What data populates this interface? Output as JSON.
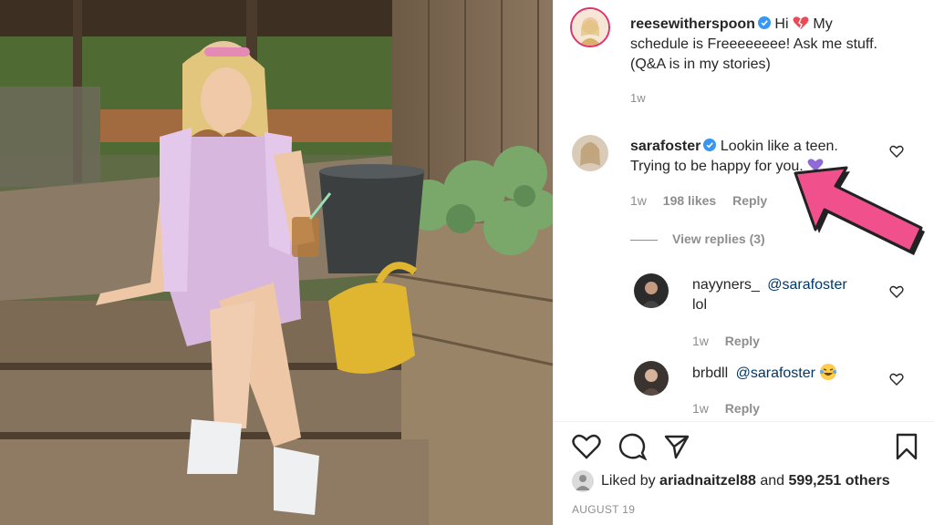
{
  "post": {
    "caption_user": "reesewitherspoon",
    "caption_text_1": "Hi",
    "caption_text_2": "My",
    "caption_line2": "schedule is Freeeeeeee! Ask me stuff.",
    "caption_line3": "(Q&A is in my stories)",
    "caption_time": "1w"
  },
  "comments": [
    {
      "user": "sarafoster",
      "text_1": "Lookin like a teen.",
      "text_2": "Trying to be happy for you.",
      "time": "1w",
      "likes": "198 likes",
      "reply": "Reply",
      "view_replies": "View replies (3)"
    }
  ],
  "replies": [
    {
      "user": "nayyners_",
      "mention": "@sarafoster",
      "text": "lol",
      "time": "1w",
      "reply": "Reply"
    },
    {
      "user": "brbdll",
      "mention": "@sarafoster",
      "text": "",
      "time": "1w",
      "reply": "Reply"
    }
  ],
  "footer": {
    "liked_by_prefix": "Liked by",
    "liked_by_user": "ariadnaitzel88",
    "liked_by_and": "and",
    "liked_by_count": "599,251 others",
    "date": "AUGUST 19"
  },
  "colors": {
    "highlight": "#f0508c",
    "verified": "#3897f0",
    "purple_heart": "#8f6ad8",
    "red_heart": "#ed4956"
  }
}
